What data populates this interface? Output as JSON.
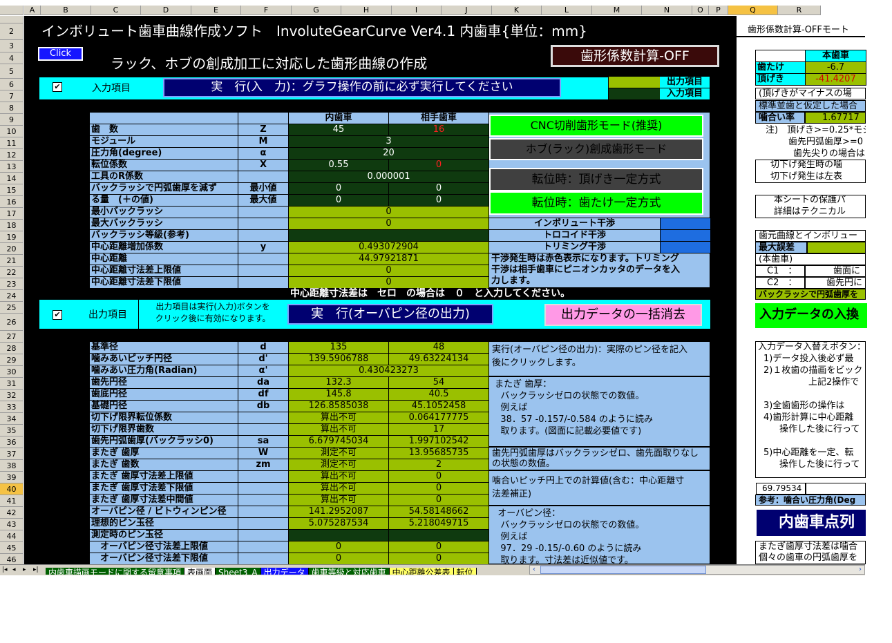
{
  "columns": [
    "A",
    "B",
    "C",
    "D",
    "E",
    "F",
    "G",
    "H",
    "I",
    "J",
    "K",
    "L",
    "M",
    "N",
    "O",
    "P",
    "Q",
    "R"
  ],
  "selected_column": "Q",
  "rows": [
    "2",
    "3",
    "4",
    "5",
    "6",
    "7",
    "8",
    "9",
    "10",
    "11",
    "12",
    "13",
    "14",
    "15",
    "16",
    "17",
    "18",
    "19",
    "20",
    "21",
    "22",
    "23",
    "24",
    "25",
    "26",
    "27",
    "28",
    "29",
    "30",
    "31",
    "32",
    "33",
    "34",
    "35",
    "36",
    "37",
    "38",
    "39",
    "40",
    "41",
    "42",
    "43",
    "44",
    "45",
    "46"
  ],
  "selected_row": "40",
  "sheet": {
    "title": "インボリュート歯車曲線作成ソフト　InvoluteGearCurve Ver4.1 内歯車{単位：mm}",
    "subtitle": "ラック、ホブの創成加工に対応した歯形曲線の作成",
    "click_button": "Click",
    "mode_button": "歯形係数計算-OFF",
    "input_section_label": "入力項目",
    "input_checkbox": "✔",
    "run_input_button": "実　行(入　力)：グラフ操作の前に必ず実行してください",
    "legend_output": "出力項目",
    "legend_input": "入力項目"
  },
  "input_table": {
    "head_internal": "内歯車",
    "head_mate": "相手歯車",
    "rows": [
      {
        "label": "歯　数",
        "sym": "Z",
        "v1": "45",
        "v2": "16"
      },
      {
        "label": "モジュール",
        "sym": "M",
        "merged": "3"
      },
      {
        "label": "圧力角(degree)",
        "sym": "α",
        "merged": "20"
      },
      {
        "label": "転位係数",
        "sym": "X",
        "v1": "0.55",
        "v2": "0"
      },
      {
        "label": "工具のR係数",
        "sym": "",
        "merged": "0.000001"
      },
      {
        "label": "バックラッシで円弧歯厚を減ず",
        "sym": "最小値",
        "v1": "0",
        "v2": "0"
      },
      {
        "label": "る量　(＋の値)",
        "sym": "最大値",
        "v1": "0",
        "v2": "0"
      },
      {
        "label": "最小バックラッシ",
        "sym": "",
        "merged": "0"
      },
      {
        "label": "最大バックラッシ",
        "sym": "",
        "merged": "0"
      },
      {
        "label": "バックラッシ等級(参考)",
        "sym": "",
        "merged": ""
      },
      {
        "label": "中心距離増加係数",
        "sym": "y",
        "merged": "0.493072904"
      },
      {
        "label": "中心距離",
        "sym": "",
        "merged": "44.97921871"
      },
      {
        "label": "中心距離寸法差上限値",
        "sym": "",
        "merged": "0"
      },
      {
        "label": "中心距離寸法差下限値",
        "sym": "",
        "merged": "0"
      }
    ],
    "note_zero": "中心距離寸法差は　セロ　の場合は　０　と入力してください。"
  },
  "mode_buttons": {
    "cnc": "CNC切削歯形モード(推奨)",
    "hob": "ホブ(ラック)創成歯形モード",
    "tip_const": "転位時：頂げき一定方式",
    "depth_const": "転位時：歯たけ一定方式"
  },
  "interference": {
    "involute": "インボリュート干渉",
    "trochoid": "トロコイド干渉",
    "trimming": "トリミング干渉",
    "note": "干渉発生時は赤色表示になります。トリミング\n干渉は相手歯車にピニオンカッタのデータを入\n力します。"
  },
  "output_header": {
    "checkbox": "✔",
    "label": "出力項目",
    "note": "出力項目は実行(入力)ボタンを\nクリック後に有効になります。",
    "run_button": "実　行(オーバピン径の出力)",
    "clear_button": "出力データの一括消去"
  },
  "output_table": {
    "rows": [
      {
        "label": "基準径",
        "sym": "d",
        "v1": "135",
        "v2": "48"
      },
      {
        "label": "噛みあいピッチ円径",
        "sym": "d'",
        "v1": "139.5906788",
        "v2": "49.63224134"
      },
      {
        "label": "噛みあい圧力角(Radian)",
        "sym": "α'",
        "merged": "0.430423273"
      },
      {
        "label": "歯先円径",
        "sym": "da",
        "v1": "132.3",
        "v2": "54"
      },
      {
        "label": "歯底円径",
        "sym": "df",
        "v1": "145.8",
        "v2": "40.5"
      },
      {
        "label": "基礎円径",
        "sym": "db",
        "v1": "126.8585038",
        "v2": "45.1052458"
      },
      {
        "label": "切下げ限界転位係数",
        "sym": "",
        "v1": "算出不可",
        "v2": "0.064177775"
      },
      {
        "label": "切下げ限界歯数",
        "sym": "",
        "v1": "算出不可",
        "v2": "17"
      },
      {
        "label": "歯先円弧歯厚(バックラッシ0)",
        "sym": "sa",
        "v1": "6.679745034",
        "v2": "1.997102542"
      },
      {
        "label": "またぎ 歯厚",
        "sym": "W",
        "v1": "測定不可",
        "v2": "13.95685735"
      },
      {
        "label": "またぎ 歯数",
        "sym": "zm",
        "v1": "測定不可",
        "v2": "2"
      },
      {
        "label": "またぎ 歯厚寸法差上限値",
        "sym": "",
        "v1": "算出不可",
        "v2": "0"
      },
      {
        "label": "またぎ 歯厚寸法差下限値",
        "sym": "",
        "v1": "算出不可",
        "v2": "0"
      },
      {
        "label": "またぎ 歯厚寸法差中間値",
        "sym": "",
        "v1": "算出不可",
        "v2": "0"
      },
      {
        "label": "オーバピン径 / ビトウィンピン径",
        "sym": "",
        "v1": "141.2952087",
        "v2": "54.58148662"
      },
      {
        "label": "理想的ピン玉径",
        "sym": "",
        "v1": "5.075287534",
        "v2": "5.218049715"
      },
      {
        "label": "測定時のピン玉径",
        "sym": "",
        "v1": "",
        "v2": ""
      },
      {
        "label": "　オーバピン径寸法差上限値",
        "sym": "",
        "v1": "0",
        "v2": "0"
      },
      {
        "label": "　オーバピン径寸法差下限値",
        "sym": "",
        "v1": "0",
        "v2": "0"
      }
    ]
  },
  "output_notes": {
    "n1": "実行(オーバピン径の出力)：実際のピン径を記入\n後にクリックします。",
    "n2": " またぎ 歯厚：\n   バックラッシゼロの状態での数値。\n   例えば\n   38．57 -0.157/-0.584 のように読み\n   取ります。(図面に記載必要値です)",
    "n3": "歯先円弧歯厚はバックラッシゼロ、歯先面取りなし\nの状態の数値。",
    "n4": "噛合いピッチ円上での計算値(含む：中心距離寸\n法差補正)",
    "n5": "  オーバピン径：\n   バックラッシゼロの状態での数値。\n   例えば\n   97．29 -0.15/-0.60 のように読み\n   取ります。寸法差は近似値です。"
  },
  "right_panel": {
    "title": "歯形係数計算-OFFモート",
    "table_head": "本歯車",
    "addendum_label": "歯たけ",
    "addendum_val": "-6.7",
    "clearance_label": "頂げき",
    "clearance_val": "-41.4207",
    "minus_note": "(頂げきがマイナスの場",
    "std_note": "標準並歯と仮定した場合",
    "ratio_label": "噛合い率",
    "ratio_val": "1.67717",
    "note1": "注)　頂げき>=0.25*モジ",
    "note2": "歯先円弧歯厚>=0",
    "note3": "歯先尖りの場合は",
    "undercut1": "切下げ発生時の噛",
    "undercut2": "切下げ発生は左表",
    "protect1": "本シートの保護パ",
    "protect2": "詳細はテクニカル",
    "root_title": "歯元曲線とインボリュー",
    "max_err": "最大誤差",
    "own_gear": "(本歯車)",
    "c1": "C1　：",
    "c1_val": "歯面に",
    "c2": "C2　：",
    "c2_val": "歯先円に",
    "bl_note": "バックラッシで円弧歯厚を",
    "replace_btn": "入力データの入換",
    "swap_title": "入力データ入替えボタン：",
    "swap1": "1)データ投入後必ず最",
    "swap2": "2)１枚歯の描画をビック",
    "swap2b": "上記2操作で",
    "swap3": "3)全歯歯形の操作は",
    "swap4": "4)歯形計算に中心距離",
    "swap4b": "操作した後に行って",
    "swap5": "5)中心距離を一定、転",
    "swap5b": "操作した後に行って",
    "cell_val": "69.79534",
    "ref_label": "参考：噛合い圧力角(Deg",
    "internal_btn": "内歯車点列",
    "bottom1": "またぎ歯厚寸法差は噛合",
    "bottom2": "個々の歯車の円弧歯厚を"
  },
  "sheet_tabs": [
    "内歯車描画モードに関する留意事項",
    "表画面",
    "Sheet3_A",
    "出力データ",
    "歯車等級と対応歯車",
    "中心距離公差表",
    "転位"
  ],
  "active_tab": "表画面",
  "colors": {
    "bg": "#000000",
    "cyan": "#00ffff",
    "label_blue": "#9bc3ee",
    "dark_green": "#0f3a0f",
    "green": "#9ac000",
    "navy": "#000070",
    "pink": "#ff99e6",
    "bright_green": "#00ff00"
  }
}
